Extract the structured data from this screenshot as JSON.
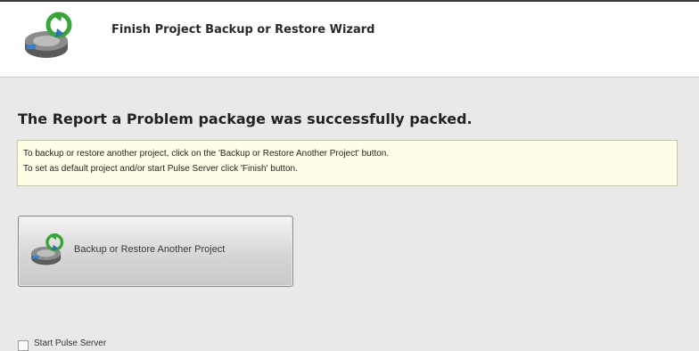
{
  "header": {
    "title": "Finish Project Backup or Restore Wizard",
    "icon": "backup-restore-icon"
  },
  "main": {
    "status_heading": "The Report a Problem package was successfully packed.",
    "info_lines": [
      "To backup or restore another project, click on the 'Backup or Restore Another Project' button.",
      "To set as default project and/or start Pulse Server click 'Finish' button."
    ],
    "another_project_button": {
      "label": "Backup or Restore Another Project",
      "icon": "backup-restore-icon"
    },
    "start_server_checkbox": {
      "label": "Start Pulse Server",
      "checked": false
    }
  },
  "colors": {
    "info_background": "#ffffe8",
    "icon_green": "#3aa43a",
    "icon_blue": "#2f6fb8"
  }
}
